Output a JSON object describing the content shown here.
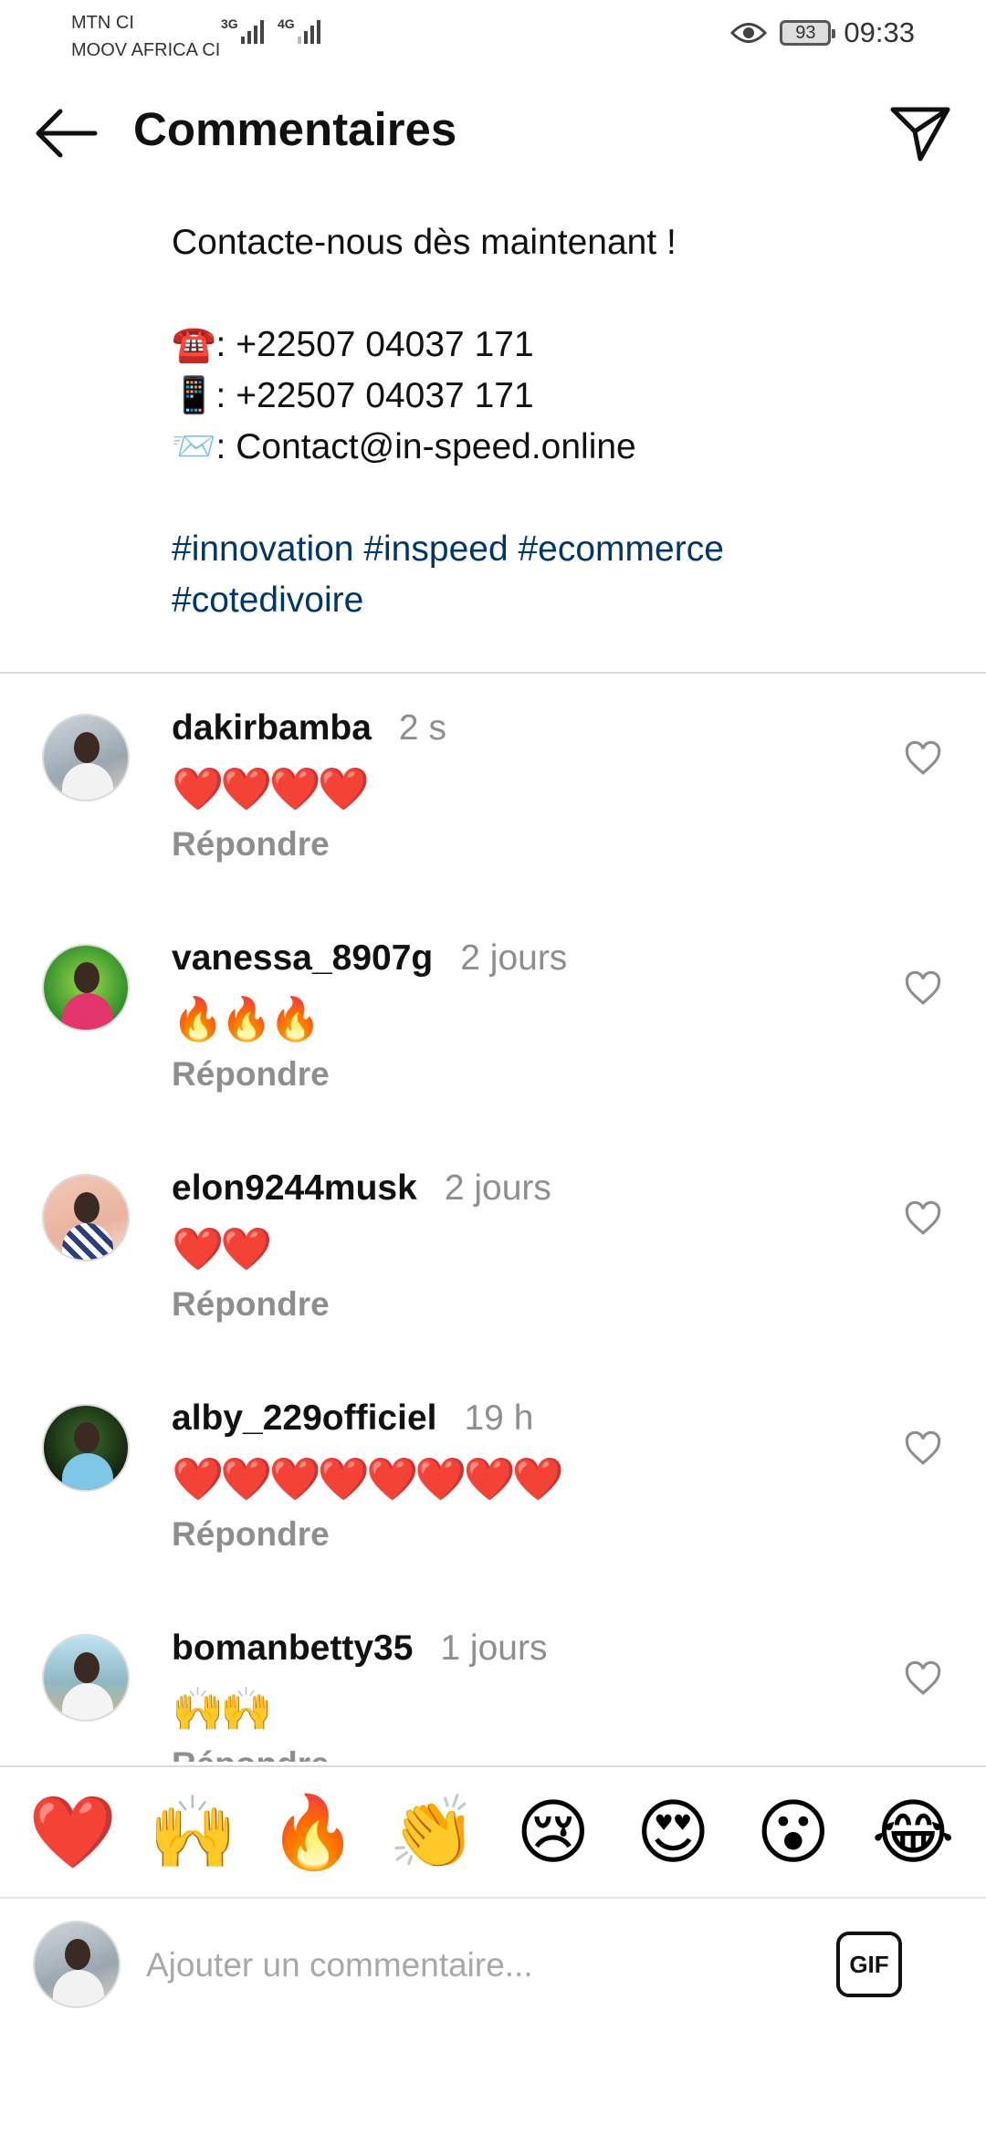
{
  "status_bar": {
    "carrier_1": "MTN CI",
    "carrier_2": "MOOV AFRICA CI",
    "network_1": "3G",
    "network_2": "4G",
    "battery": "93",
    "time": "09:33",
    "icons": [
      "signal-icon",
      "eye-icon",
      "battery-icon"
    ]
  },
  "header": {
    "title": "Commentaires",
    "back_icon": "arrow-left-icon",
    "share_icon": "paper-plane-icon"
  },
  "caption": {
    "lines": [
      "Contacte-nous dès maintenant !",
      "",
      "☎️: +22507 04037 171",
      "📱: +22507 04037 171",
      "📨: Contact@in-speed.online",
      ""
    ],
    "hashtags_line_1": "#innovation #inspeed #ecommerce",
    "hashtags_line_2": "#cotedivoire"
  },
  "comments": [
    {
      "username": "dakirbamba",
      "time": "2 s",
      "text": "❤️❤️❤️❤️",
      "reply": "Répondre"
    },
    {
      "username": "vanessa_8907g",
      "time": "2 jours",
      "text": "🔥🔥🔥",
      "reply": "Répondre"
    },
    {
      "username": "elon9244musk",
      "time": "2 jours",
      "text": "❤️❤️",
      "reply": "Répondre"
    },
    {
      "username": "alby_229officiel",
      "time": "19 h",
      "text": "❤️❤️❤️❤️❤️❤️❤️❤️",
      "reply": "Répondre"
    },
    {
      "username": "bomanbetty35",
      "time": "1 jours",
      "text": "🙌🙌",
      "reply": "Répondre"
    }
  ],
  "emoji_bar": [
    "❤️",
    "🙌",
    "🔥",
    "👏",
    "😢",
    "😍",
    "😮",
    "😂"
  ],
  "composer": {
    "placeholder": "Ajouter un commentaire...",
    "gif_label": "GIF"
  },
  "colors": {
    "hashtag": "#00376b",
    "meta_gray": "#8e8e8e",
    "divider": "#dbdbdb"
  }
}
